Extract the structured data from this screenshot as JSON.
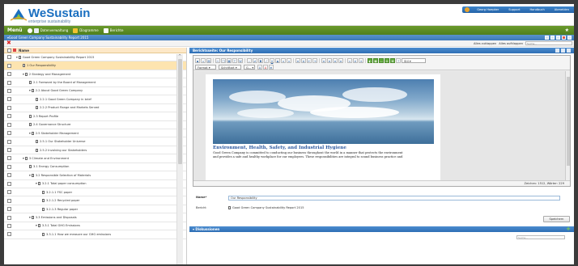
{
  "header": {
    "logo_name": "WeSustain",
    "logo_tagline": "enterprise sustainability",
    "user_name": "Georg Hoepker",
    "links": [
      "Support",
      "Handbuch",
      "Abmelden"
    ]
  },
  "menu": {
    "title": "Menü",
    "items": [
      {
        "label": "Datenverwaltung",
        "icon": "database-icon"
      },
      {
        "label": "Diagramme",
        "icon": "chart-icon"
      },
      {
        "label": "Berichte",
        "icon": "document-icon"
      }
    ]
  },
  "report_title": "Good Green Company Sustainability Report 2015",
  "toolbar": {
    "collapse_all": "Alles zuklappen",
    "expand_all": "Alles aufklappen",
    "search_placeholder": "Suche..."
  },
  "tree": {
    "header": "Name",
    "rows": [
      {
        "label": "Good Green Company Sustainability Report 2015",
        "indent": 0,
        "toggle": "▾",
        "selected": false
      },
      {
        "label": "1 Our Responsibility",
        "indent": 1,
        "toggle": "",
        "selected": true
      },
      {
        "label": "2 Strategy and Management",
        "indent": 1,
        "toggle": "▾",
        "selected": false
      },
      {
        "label": "2.1 Foreword by the Board of Management",
        "indent": 2,
        "toggle": "",
        "selected": false
      },
      {
        "label": "2.2 About Good Green Company",
        "indent": 2,
        "toggle": "▾",
        "selected": false
      },
      {
        "label": "2.2.1 Good Green Company in brief",
        "indent": 3,
        "toggle": "",
        "selected": false
      },
      {
        "label": "2.2.2 Product Range and Markets Served",
        "indent": 3,
        "toggle": "",
        "selected": false
      },
      {
        "label": "2.3 Report Profile",
        "indent": 2,
        "toggle": "",
        "selected": false
      },
      {
        "label": "2.4 Governance Structure",
        "indent": 2,
        "toggle": "",
        "selected": false
      },
      {
        "label": "2.5 Stakeholder Management",
        "indent": 2,
        "toggle": "▾",
        "selected": false
      },
      {
        "label": "2.5.1 Our Stakeholder Universe",
        "indent": 3,
        "toggle": "",
        "selected": false
      },
      {
        "label": "2.5.2 Involving our Stakeholders",
        "indent": 3,
        "toggle": "",
        "selected": false
      },
      {
        "label": "3 Climate and Environment",
        "indent": 1,
        "toggle": "▾",
        "selected": false
      },
      {
        "label": "3.1 Energy Consumption",
        "indent": 2,
        "toggle": "",
        "selected": false
      },
      {
        "label": "3.2 Responsible Selection of Materials",
        "indent": 2,
        "toggle": "▾",
        "selected": false
      },
      {
        "label": "3.2.1 Total paper consumption",
        "indent": 3,
        "toggle": "▾",
        "selected": false
      },
      {
        "label": "3.2.1.1 FSC paper",
        "indent": 4,
        "toggle": "",
        "selected": false
      },
      {
        "label": "3.2.1.2 Recycled paper",
        "indent": 4,
        "toggle": "",
        "selected": false
      },
      {
        "label": "3.2.1.3 Regular paper",
        "indent": 4,
        "toggle": "",
        "selected": false
      },
      {
        "label": "3.3 Emissions and Disposals",
        "indent": 2,
        "toggle": "▾",
        "selected": false
      },
      {
        "label": "3.3.1 Total GHG Emissions",
        "indent": 3,
        "toggle": "▾",
        "selected": false
      },
      {
        "label": "3.3.1.1 How we measure our GHG emissions",
        "indent": 4,
        "toggle": "",
        "selected": false
      }
    ]
  },
  "section_panel": {
    "title": "Berichtsseite: Our Responsibility"
  },
  "editor": {
    "format_label": "Format",
    "font_label": "Schriftart",
    "size_label": "G...",
    "style_label": "Stil",
    "page_heading": "Environment, Health, Safety, and Industrial Hygiene",
    "page_text_1": "Good Green Company is committed to conducting our business throughout the world in a manner that protects the environment",
    "page_text_2": "and provides a safe and healthy workplace for our employees. These responsibilities are integral to sound business practice and",
    "status": "Zeichen: 1512, Wörter: 229"
  },
  "form": {
    "name_label": "Name*",
    "name_value": "Our Responsibility",
    "doc_label": "Bericht",
    "doc_value": "Good Green Company Sustainability Report 2015",
    "save_label": "Speichern"
  },
  "discussion": {
    "title": "Diskussionen",
    "search_placeholder": "Suche..."
  },
  "colors": {
    "brand_blue": "#1a6fc0",
    "menu_green": "#5a8c24",
    "panel_blue": "#3b78b8",
    "selection": "#fde4b0"
  }
}
